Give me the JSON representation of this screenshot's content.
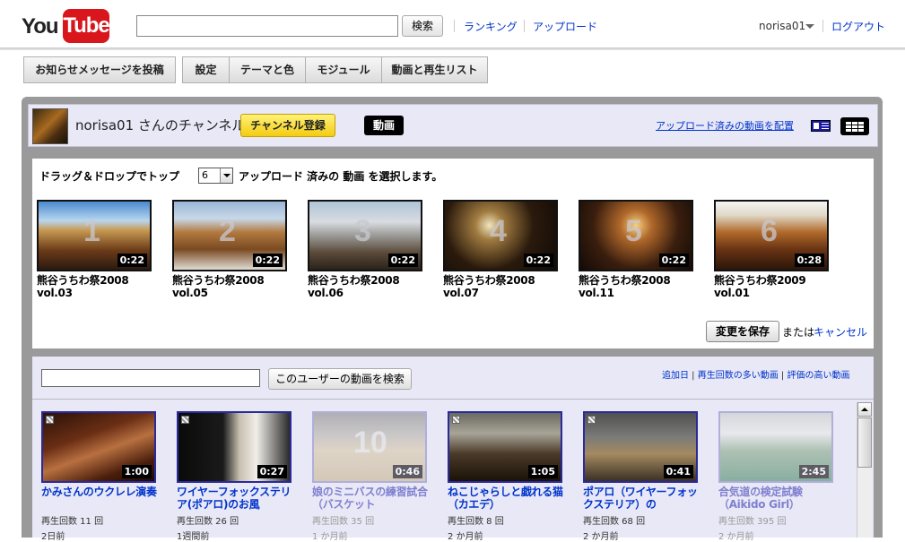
{
  "header": {
    "logo_you": "You",
    "logo_tube": "Tube",
    "search_button": "検索",
    "nav_ranking": "ランキング",
    "nav_upload": "アップロード",
    "username": "norisa01",
    "logout": "ログアウト"
  },
  "toolbar": {
    "post_bulletin": "お知らせメッセージを投稿",
    "settings": "設定",
    "themes": "テーマと色",
    "modules": "モジュール",
    "videos_playlists": "動画と再生リスト"
  },
  "channel": {
    "name": "norisa01 さんのチャンネル",
    "subscribe": "チャンネル登録",
    "tab_videos": "動画",
    "arrange_link": "アップロード済みの動画を配置"
  },
  "editor": {
    "label_before": "ドラッグ＆ドロップでトップ",
    "count_value": "6",
    "label_after": "アップロード 済みの 動画 を選択します。",
    "save_button": "変更を保存",
    "or_text": "または",
    "cancel_link": "キャンセル",
    "featured": [
      {
        "num": "1",
        "duration": "0:22",
        "title_line1": "熊谷うちわ祭2008",
        "title_line2": "vol.03"
      },
      {
        "num": "2",
        "duration": "0:22",
        "title_line1": "熊谷うちわ祭2008",
        "title_line2": "vol.05"
      },
      {
        "num": "3",
        "duration": "0:22",
        "title_line1": "熊谷うちわ祭2008",
        "title_line2": "vol.06"
      },
      {
        "num": "4",
        "duration": "0:22",
        "title_line1": "熊谷うちわ祭2008",
        "title_line2": "vol.07"
      },
      {
        "num": "5",
        "duration": "0:22",
        "title_line1": "熊谷うちわ祭2008",
        "title_line2": "vol.11"
      },
      {
        "num": "6",
        "duration": "0:28",
        "title_line1": "熊谷うちわ祭2009",
        "title_line2": "vol.01"
      }
    ]
  },
  "library": {
    "search_button": "このユーザーの動画を検索",
    "sort_links": [
      "追加日",
      "再生回数の多い動画",
      "評価の高い動画"
    ],
    "sort_sep": " | ",
    "videos": [
      {
        "num": "",
        "duration": "1:00",
        "title": "かみさんのウクレレ演奏",
        "views": "再生回数 11 回",
        "age": "2日前"
      },
      {
        "num": "",
        "duration": "0:27",
        "title": "ワイヤーフォックステリア(ポアロ)のお風",
        "views": "再生回数 26 回",
        "age": "1週間前"
      },
      {
        "num": "10",
        "duration": "0:46",
        "title": "娘のミニバスの練習試合（バスケット",
        "views": "再生回数 35 回",
        "age": "1 か月前"
      },
      {
        "num": "",
        "duration": "1:05",
        "title": "ねこじゃらしと戯れる猫（カエデ）",
        "views": "再生回数 8 回",
        "age": "2 か月前"
      },
      {
        "num": "",
        "duration": "0:41",
        "title": "ポアロ（ワイヤーフォックステリア）の",
        "views": "再生回数 68 回",
        "age": "2 か月前"
      },
      {
        "num": "",
        "duration": "2:45",
        "title": "合気道の検定試験（Aikido Girl）",
        "views": "再生回数 395 回",
        "age": "2 か月前"
      }
    ]
  }
}
